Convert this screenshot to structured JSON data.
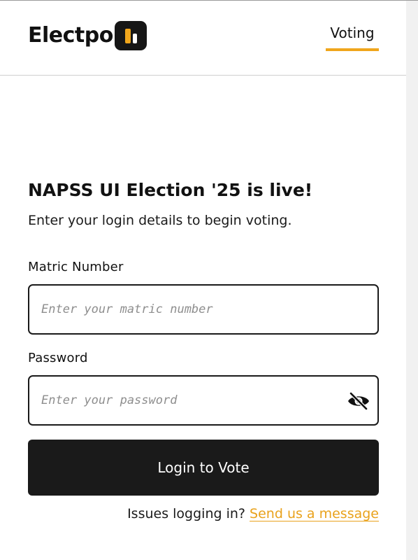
{
  "header": {
    "logo_text": "Electpo",
    "nav": {
      "voting_label": "Voting"
    }
  },
  "hero": {
    "title": "NAPSS UI Election '25 is live!",
    "subtitle": "Enter your login details to begin voting."
  },
  "form": {
    "matric": {
      "label": "Matric Number",
      "placeholder": "Enter your matric number",
      "value": ""
    },
    "password": {
      "label": "Password",
      "placeholder": "Enter your password",
      "value": "",
      "toggle_icon": "eye-slash-icon"
    },
    "submit_label": "Login to Vote"
  },
  "help": {
    "prompt": "Issues logging in?",
    "link_label": "Send us a message"
  },
  "colors": {
    "accent": "#f0a61c",
    "link": "#e9a21c",
    "button_bg": "#1a1a1a",
    "text": "#111111"
  }
}
